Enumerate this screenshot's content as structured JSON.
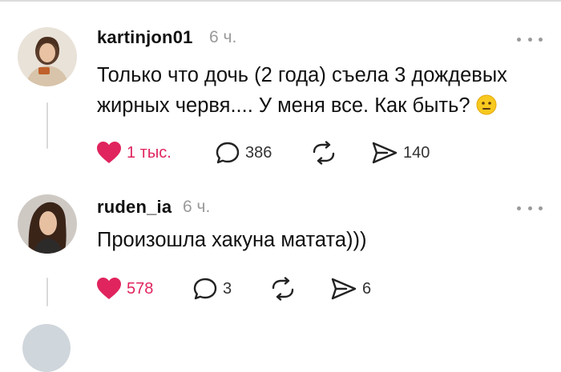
{
  "posts": [
    {
      "username": "kartinjon01",
      "time": "6 ч.",
      "text": "Только что дочь (2 года) съела 3 дождевых жирных червя.... У меня все. Как быть?",
      "emoji": "neutral-face-emoji",
      "likes": "1 тыс.",
      "comments": "386",
      "reposts": "",
      "shares": "140",
      "liked": true
    },
    {
      "username": "ruden_ia",
      "time": "6 ч.",
      "text": "Произошла хакуна матата)))",
      "likes": "578",
      "comments": "3",
      "reposts": "",
      "shares": "6",
      "liked": true
    }
  ],
  "icons": {
    "like": "heart-icon",
    "comment": "comment-bubble-icon",
    "repost": "repost-icon",
    "share": "share-send-icon",
    "more": "more-dots-icon"
  },
  "colors": {
    "like": "#e0245e",
    "text": "#111111",
    "muted": "#9a9a9a"
  }
}
